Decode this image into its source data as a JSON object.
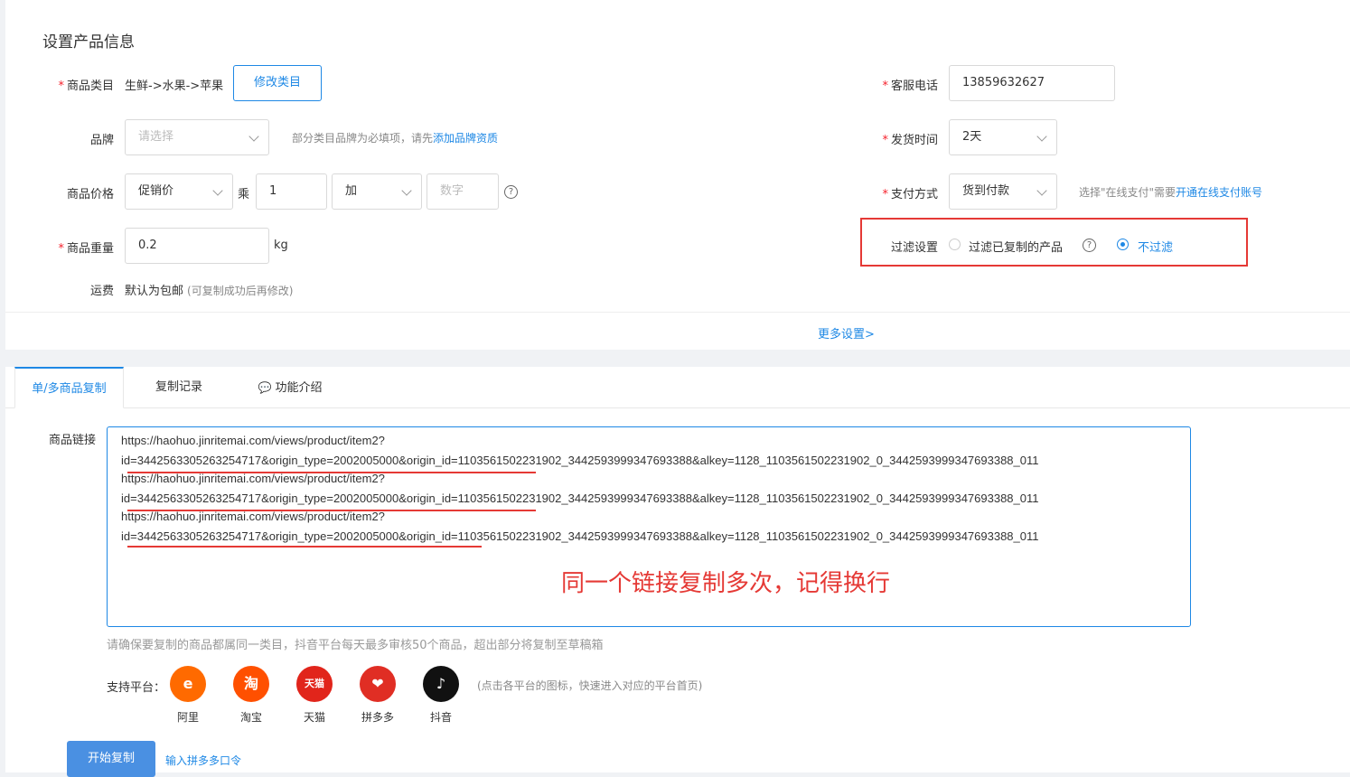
{
  "section_title": "设置产品信息",
  "category": {
    "label": "商品类目",
    "value": "生鲜->水果->苹果",
    "button": "修改类目"
  },
  "brand": {
    "label": "品牌",
    "placeholder": "请选择",
    "hint_prefix": "部分类目品牌为必填项，请先",
    "hint_link": "添加品牌资质"
  },
  "price": {
    "label": "商品价格",
    "type_value": "促销价",
    "multiply_label": "乘",
    "multiply_value": "1",
    "op_value": "加",
    "number_placeholder": "数字",
    "help": "?"
  },
  "weight": {
    "label": "商品重量",
    "value": "0.2",
    "unit": "kg"
  },
  "shipping_fee": {
    "label": "运费",
    "value": "默认为包邮",
    "hint": "(可复制成功后再修改)"
  },
  "phone": {
    "label": "客服电话",
    "value": "13859632627"
  },
  "ship_time": {
    "label": "发货时间",
    "value": "2天"
  },
  "payment": {
    "label": "支付方式",
    "value": "货到付款",
    "hint_prefix": "选择\"在线支付\"需要",
    "hint_link": "开通在线支付账号"
  },
  "filter": {
    "label": "过滤设置",
    "option1": "过滤已复制的产品",
    "option2": "不过滤",
    "selected": "不过滤",
    "help": "?"
  },
  "more_settings": "更多设置>",
  "tabs": [
    {
      "label": "单/多商品复制"
    },
    {
      "label": "复制记录"
    },
    {
      "label": "功能介绍"
    }
  ],
  "link_field": {
    "label": "商品链接",
    "lines": [
      "https://haohuo.jinritemai.com/views/product/item2?",
      "id=3442563305263254717&origin_type=2002005000&origin_id=1103561502231902_3442593999347693388&alkey=1128_1103561502231902_0_3442593999347693388_011",
      "https://haohuo.jinritemai.com/views/product/item2?",
      "id=3442563305263254717&origin_type=2002005000&origin_id=1103561502231902_3442593999347693388&alkey=1128_1103561502231902_0_3442593999347693388_011",
      "https://haohuo.jinritemai.com/views/product/item2?",
      "id=3442563305263254717&origin_type=2002005000&origin_id=1103561502231902_3442593999347693388&alkey=1128_1103561502231902_0_3442593999347693388_011"
    ],
    "annotation": "同一个链接复制多次，记得换行",
    "annotation_color": "#e53935"
  },
  "notice": "请确保要复制的商品都属同一类目，抖音平台每天最多审核50个商品，超出部分将复制至草稿箱",
  "platforms": {
    "label": "支持平台：",
    "hint": "(点击各平台的图标，快速进入对应的平台首页)",
    "items": [
      {
        "name": "阿里",
        "icon": "alibaba-icon",
        "color": "#ff6a00"
      },
      {
        "name": "淘宝",
        "icon": "taobao-icon",
        "color": "#ff5000"
      },
      {
        "name": "天猫",
        "icon": "tmall-icon",
        "color": "#e1251b"
      },
      {
        "name": "拼多多",
        "icon": "pinduoduo-icon",
        "color": "#e02e24"
      },
      {
        "name": "抖音",
        "icon": "douyin-icon",
        "color": "#111111"
      }
    ]
  },
  "start_button": "开始复制",
  "pdd_link": "输入拼多多口令",
  "accent_color": "#1e88e5",
  "highlight_color": "#e53935"
}
